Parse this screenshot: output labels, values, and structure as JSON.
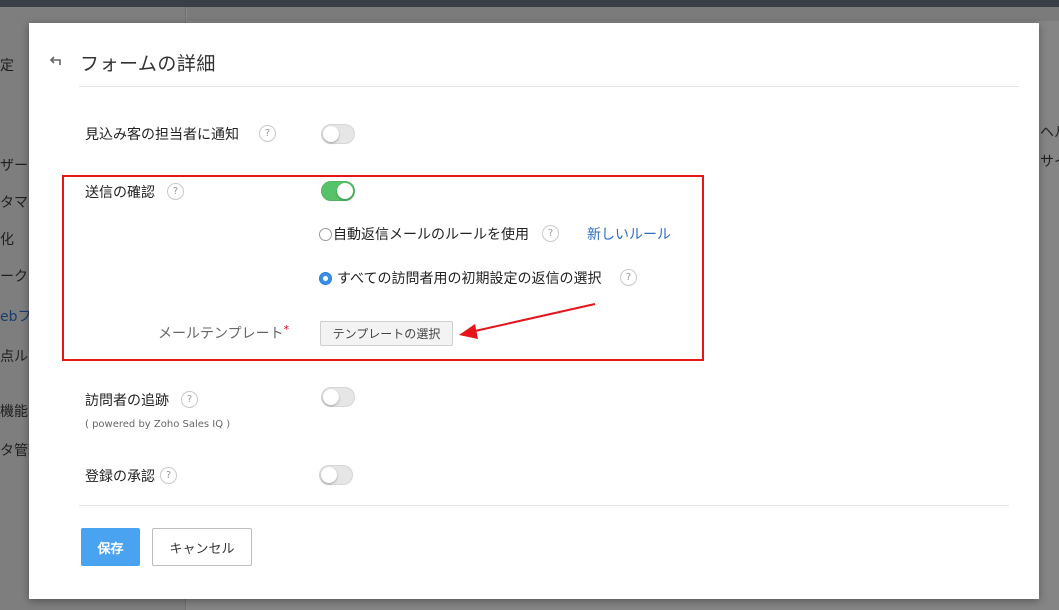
{
  "background": {
    "sidebar_fragments": [
      "定",
      "ザー管",
      "タマイ",
      "化",
      "ーク",
      "ebフ",
      "点ル",
      "機能&",
      "タ管理"
    ],
    "right_fragments": [
      "ヘル",
      "サイ"
    ]
  },
  "modal": {
    "title": "フォームの詳細",
    "help_glyph": "?",
    "notify_owner": {
      "label": "見込み客の担当者に通知",
      "enabled": false
    },
    "send_confirmation": {
      "label": "送信の確認",
      "enabled": true,
      "options": [
        {
          "label": "自動返信メールのルールを使用",
          "selected": false
        },
        {
          "label": "すべての訪問者用の初期設定の返信の選択",
          "selected": true
        }
      ],
      "new_rule_link": "新しいルール",
      "mail_template_label": "メールテンプレート",
      "required_mark": "*",
      "select_template_button": "テンプレートの選択"
    },
    "visitor_tracking": {
      "label": "訪問者の追跡",
      "sub_label": "( powered by Zoho Sales IQ )",
      "enabled": false
    },
    "registration_approval": {
      "label": "登録の承認",
      "enabled": false
    },
    "footer": {
      "save": "保存",
      "cancel": "キャンセル"
    }
  },
  "colors": {
    "accent_blue": "#4aa3f0",
    "toggle_on": "#58c26a",
    "link": "#2a6fc0",
    "annotation_red": "#e4161c"
  }
}
